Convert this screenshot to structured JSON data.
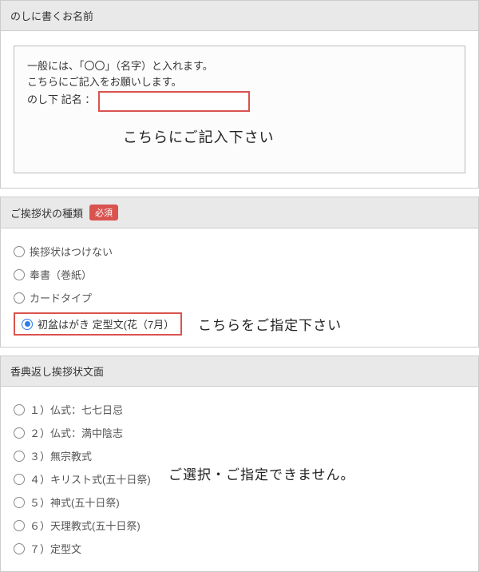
{
  "section1": {
    "title": "のしに書くお名前",
    "note_line1": "一般には、「〇〇」（名字）と入れます。",
    "note_line2": "こちらにご記入をお願いします。",
    "name_prefix": "のし下 記名 ： ",
    "hint": "こちらにご記入下さい"
  },
  "section2": {
    "title": "ご挨拶状の種類",
    "required_badge": "必須",
    "options": [
      "挨拶状はつけない",
      "奉書（巻紙）",
      "カードタイプ"
    ],
    "highlighted_option": "初盆はがき 定型文(花（7月）",
    "hint": "こちらをご指定下さい"
  },
  "section3": {
    "title": "香典返し挨拶状文面",
    "options": [
      "１）仏式：七七日忌",
      "２）仏式：満中陰志",
      "３）無宗教式",
      "４）キリスト式(五十日祭)",
      "５）神式(五十日祭)",
      "６）天理教式(五十日祭)",
      "７）定型文"
    ],
    "hint": "ご選択・ご指定できません。"
  }
}
